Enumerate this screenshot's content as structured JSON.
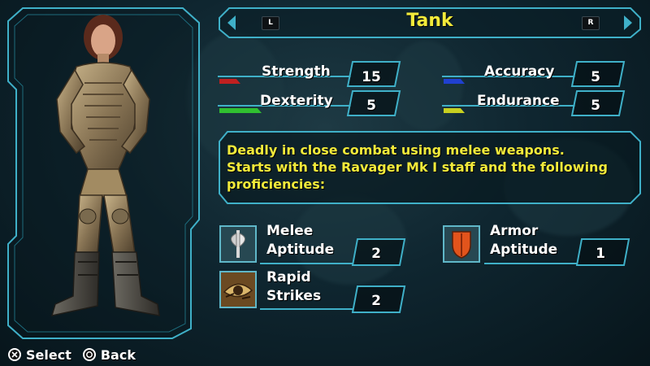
{
  "class_select": {
    "title": "Tank",
    "left_shoulder": "L",
    "right_shoulder": "R"
  },
  "stats": {
    "strength": {
      "label": "Strength",
      "value": "15",
      "color": "#c02020"
    },
    "dexterity": {
      "label": "Dexterity",
      "value": "5",
      "color": "#30c030"
    },
    "accuracy": {
      "label": "Accuracy",
      "value": "5",
      "color": "#2040d0"
    },
    "endurance": {
      "label": "Endurance",
      "value": "5",
      "color": "#c8d020"
    }
  },
  "description": {
    "line1": "Deadly in close combat using melee weapons.",
    "line2": "Starts with the Ravager Mk I staff and the following",
    "line3": "proficiencies:"
  },
  "proficiencies": [
    {
      "line1": "Melee",
      "line2": "Aptitude",
      "value": "2",
      "icon": "axe-icon"
    },
    {
      "line1": "Armor",
      "line2": "Aptitude",
      "value": "1",
      "icon": "shield-icon"
    },
    {
      "line1": "Rapid",
      "line2": "Strikes",
      "value": "2",
      "icon": "eye-icon"
    }
  ],
  "controls": {
    "select_label": "Select",
    "back_label": "Back"
  },
  "colors": {
    "frame": "#3fb0c8",
    "title": "#f2ea3a",
    "description": "#f2ea3a"
  }
}
